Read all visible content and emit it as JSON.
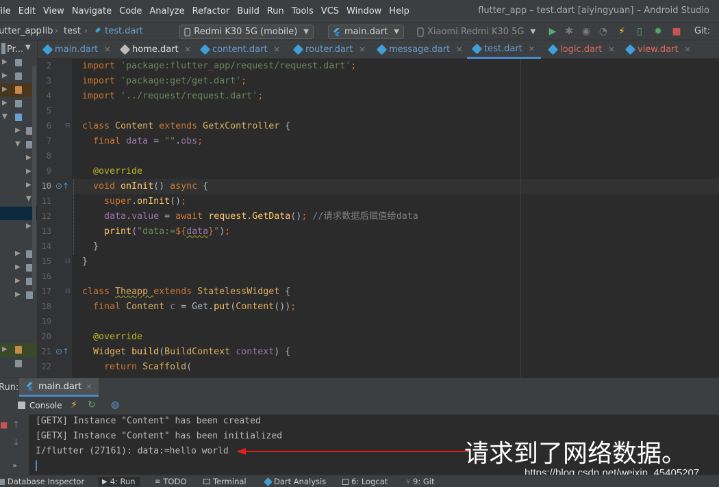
{
  "menu": [
    "File",
    "Edit",
    "View",
    "Navigate",
    "Code",
    "Analyze",
    "Refactor",
    "Build",
    "Run",
    "Tools",
    "VCS",
    "Window",
    "Help"
  ],
  "window_title": "flutter_app – test.dart [aiyingyuan] – Android Studio",
  "breadcrumb": {
    "project": "flutter_app",
    "folder": "lib",
    "subfolder": "test",
    "file": "test.dart"
  },
  "device_selector": "Redmi K30 5G (mobile)",
  "run_config": "main.dart",
  "target_device": "Xiaomi Redmi K30 5G",
  "git_label": "Git:",
  "sidebar_header": "Pr...",
  "tabs": [
    "main.dart",
    "home.dart",
    "content.dart",
    "router.dart",
    "message.dart",
    "test.dart",
    "logic.dart",
    "view.dart"
  ],
  "code": [
    {
      "n": "2",
      "t": "import 'package:flutter_app/request/request.dart';"
    },
    {
      "n": "3",
      "t": "import 'package:get/get.dart';"
    },
    {
      "n": "4",
      "t": "import '../request/request.dart';"
    },
    {
      "n": "5",
      "t": ""
    },
    {
      "n": "6",
      "t": "class Content extends GetxController {"
    },
    {
      "n": "7",
      "t": "  final data = \"\".obs;"
    },
    {
      "n": "8",
      "t": ""
    },
    {
      "n": "9",
      "t": "  @override"
    },
    {
      "n": "10",
      "t": "  void onInit() async {"
    },
    {
      "n": "11",
      "t": "    super.onInit();"
    },
    {
      "n": "12",
      "t": "    data.value = await request.GetData(); //请求数据后赋值给data"
    },
    {
      "n": "13",
      "t": "    print(\"data:=${data}\");"
    },
    {
      "n": "14",
      "t": "  }"
    },
    {
      "n": "15",
      "t": "}"
    },
    {
      "n": "16",
      "t": ""
    },
    {
      "n": "17",
      "t": "class Theapp extends StatelessWidget {"
    },
    {
      "n": "18",
      "t": "  final Content c = Get.put(Content());"
    },
    {
      "n": "19",
      "t": ""
    },
    {
      "n": "20",
      "t": "  @override"
    },
    {
      "n": "21",
      "t": "  Widget build(BuildContext context) {"
    },
    {
      "n": "22",
      "t": "    return Scaffold("
    }
  ],
  "run_panel": {
    "label": "Run:",
    "tab": "main.dart",
    "console_label": "Console",
    "output": [
      "[GETX] Instance \"Content\" has been created",
      "[GETX] Instance \"Content\" has been initialized",
      "I/flutter (27161): data:=hello world"
    ]
  },
  "annotation_text": "请求到了网络数据。",
  "watermark": "https://blog.csdn.net/weixin_45405207",
  "bottom_tools": [
    "Database Inspector",
    "4: Run",
    "TODO",
    "Terminal",
    "Dart Analysis",
    "6: Logcat",
    "9: Git"
  ],
  "colors": {
    "accent": "#4a88c7",
    "annotation_arrow": "#e02020",
    "keyword": "#cc7832",
    "string": "#6a8759"
  }
}
